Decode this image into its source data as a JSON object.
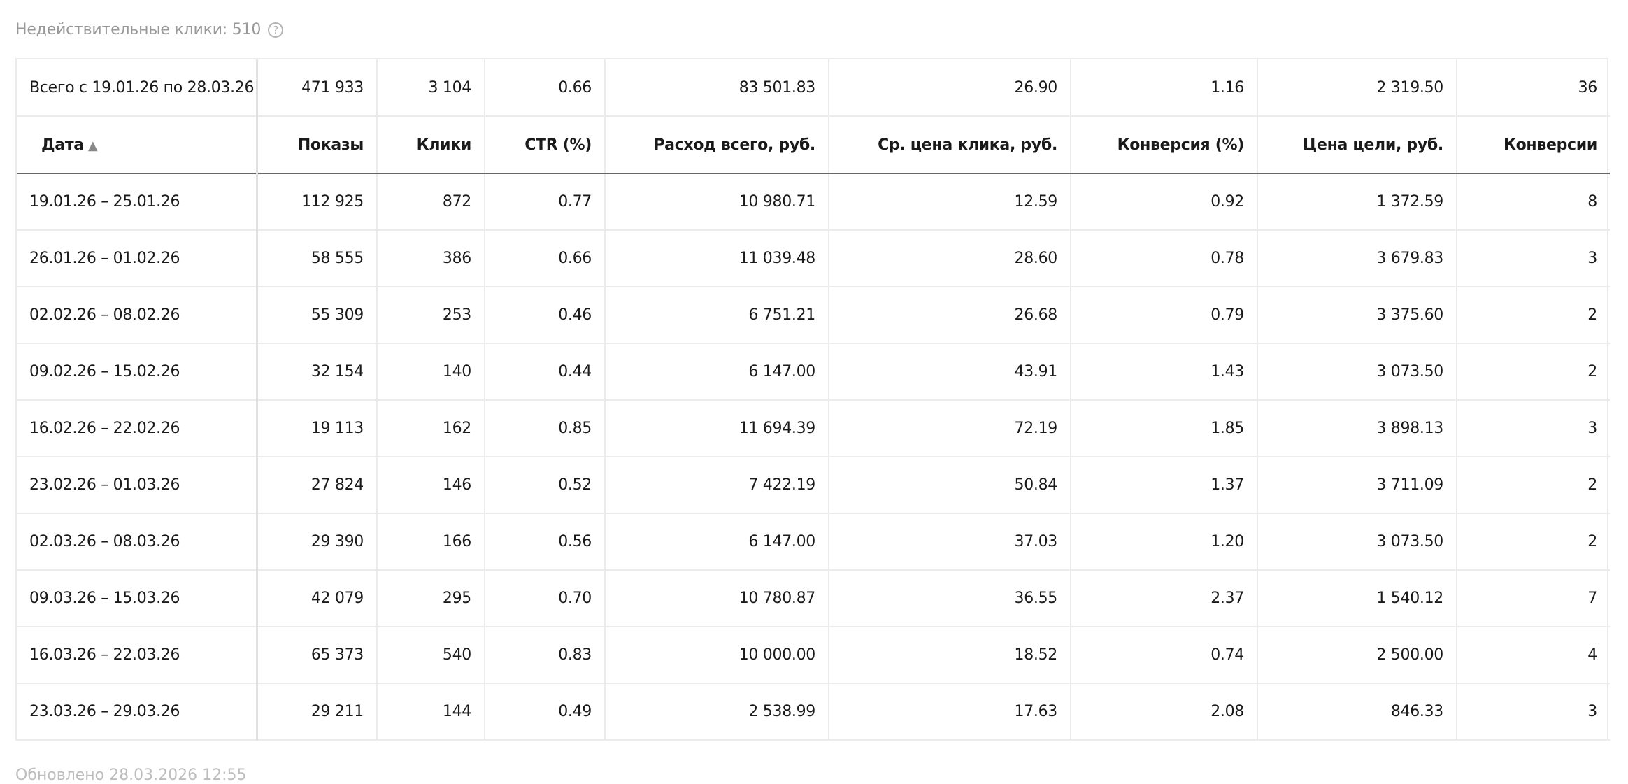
{
  "invalid_clicks": {
    "label": "Недействительные клики: 510",
    "help_glyph": "?"
  },
  "table": {
    "total_row": [
      "Всего с 19.01.26 по 28.03.26",
      "471 933",
      "3 104",
      "0.66",
      "83 501.83",
      "26.90",
      "1.16",
      "2 319.50",
      "36"
    ],
    "headers": [
      "Дата",
      "Показы",
      "Клики",
      "CTR (%)",
      "Расход всего, руб.",
      "Ср. цена клика, руб.",
      "Конверсия (%)",
      "Цена цели, руб.",
      "Конверсии"
    ],
    "sort_indicator": "▲",
    "rows": [
      [
        "19.01.26 – 25.01.26",
        "112 925",
        "872",
        "0.77",
        "10 980.71",
        "12.59",
        "0.92",
        "1 372.59",
        "8"
      ],
      [
        "26.01.26 – 01.02.26",
        "58 555",
        "386",
        "0.66",
        "11 039.48",
        "28.60",
        "0.78",
        "3 679.83",
        "3"
      ],
      [
        "02.02.26 – 08.02.26",
        "55 309",
        "253",
        "0.46",
        "6 751.21",
        "26.68",
        "0.79",
        "3 375.60",
        "2"
      ],
      [
        "09.02.26 – 15.02.26",
        "32 154",
        "140",
        "0.44",
        "6 147.00",
        "43.91",
        "1.43",
        "3 073.50",
        "2"
      ],
      [
        "16.02.26 – 22.02.26",
        "19 113",
        "162",
        "0.85",
        "11 694.39",
        "72.19",
        "1.85",
        "3 898.13",
        "3"
      ],
      [
        "23.02.26 – 01.03.26",
        "27 824",
        "146",
        "0.52",
        "7 422.19",
        "50.84",
        "1.37",
        "3 711.09",
        "2"
      ],
      [
        "02.03.26 – 08.03.26",
        "29 390",
        "166",
        "0.56",
        "6 147.00",
        "37.03",
        "1.20",
        "3 073.50",
        "2"
      ],
      [
        "09.03.26 – 15.03.26",
        "42 079",
        "295",
        "0.70",
        "10 780.87",
        "36.55",
        "2.37",
        "1 540.12",
        "7"
      ],
      [
        "16.03.26 – 22.03.26",
        "65 373",
        "540",
        "0.83",
        "10 000.00",
        "18.52",
        "0.74",
        "2 500.00",
        "4"
      ],
      [
        "23.03.26 – 29.03.26",
        "29 211",
        "144",
        "0.49",
        "2 538.99",
        "17.63",
        "2.08",
        "846.33",
        "3"
      ]
    ]
  },
  "footer": {
    "note": "Обновлено 28.03.2026 12:55"
  }
}
